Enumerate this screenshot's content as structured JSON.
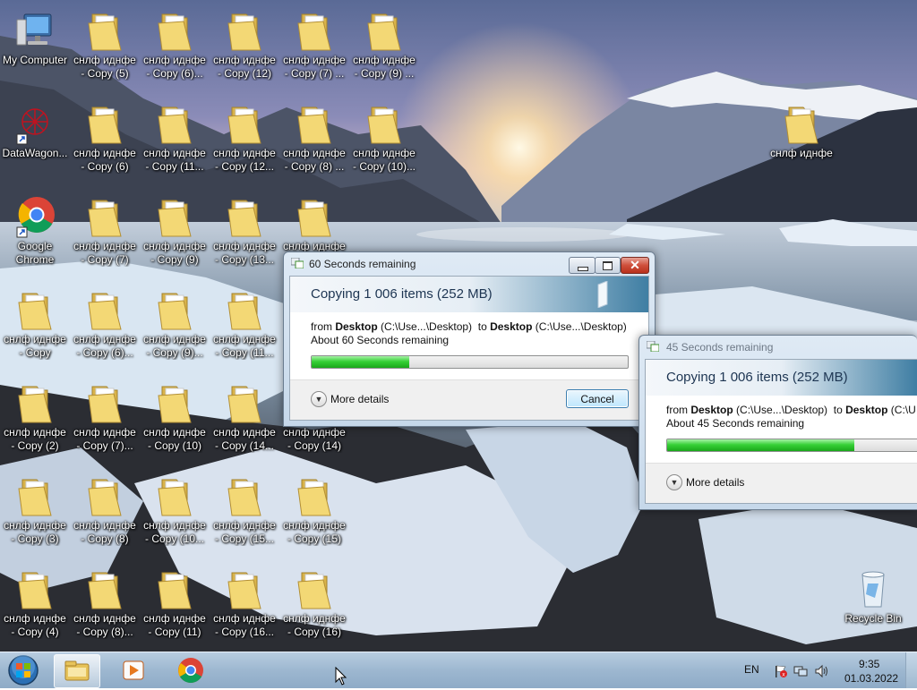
{
  "desktop": {
    "icons": [
      {
        "label": "My Computer",
        "kind": "computer"
      },
      {
        "label": "DataWagon...",
        "kind": "app"
      },
      {
        "label": "Google Chrome",
        "kind": "chrome"
      },
      {
        "label": "снлф иднфе - Copy",
        "kind": "folder"
      },
      {
        "label": "снлф иднфе - Copy (2)",
        "kind": "folder"
      },
      {
        "label": "снлф иднфе - Copy (3)",
        "kind": "folder"
      },
      {
        "label": "снлф иднфе - Copy (4)",
        "kind": "folder"
      },
      {
        "label": "снлф иднфе - Copy (5)",
        "kind": "folder"
      },
      {
        "label": "снлф иднфе - Copy (6)",
        "kind": "folder"
      },
      {
        "label": "снлф иднфе - Copy (7)",
        "kind": "folder"
      },
      {
        "label": "снлф иднфе - Copy (6)...",
        "kind": "folder"
      },
      {
        "label": "снлф иднфе - Copy (7)...",
        "kind": "folder"
      },
      {
        "label": "снлф иднфе - Copy (8)",
        "kind": "folder"
      },
      {
        "label": "снлф иднфе - Copy (8)...",
        "kind": "folder"
      },
      {
        "label": "снлф иднфе - Copy (6)...",
        "kind": "folder"
      },
      {
        "label": "снлф иднфе - Copy (11...",
        "kind": "folder"
      },
      {
        "label": "снлф иднфе - Copy (9)",
        "kind": "folder"
      },
      {
        "label": "снлф иднфе - Copy (9)...",
        "kind": "folder"
      },
      {
        "label": "снлф иднфе - Copy (10)",
        "kind": "folder"
      },
      {
        "label": "снлф иднфе - Copy (10...",
        "kind": "folder"
      },
      {
        "label": "снлф иднфе - Copy (11)",
        "kind": "folder"
      },
      {
        "label": "снлф иднфе - Copy (12)",
        "kind": "folder"
      },
      {
        "label": "снлф иднфе - Copy (12...",
        "kind": "folder"
      },
      {
        "label": "снлф иднфе - Copy (13...",
        "kind": "folder"
      },
      {
        "label": "снлф иднфе - Copy (11...",
        "kind": "folder"
      },
      {
        "label": "снлф иднфе - Copy (14...",
        "kind": "folder"
      },
      {
        "label": "снлф иднфе - Copy (15...",
        "kind": "folder"
      },
      {
        "label": "снлф иднфе - Copy (16...",
        "kind": "folder"
      },
      {
        "label": "снлф иднфе - Copy (7) ...",
        "kind": "folder"
      },
      {
        "label": "снлф иднфе - Copy (8) ...",
        "kind": "folder"
      },
      {
        "label": "снлф иднфе",
        "kind": "folder"
      },
      {
        "label": "снлф иднфе - Copy (14)",
        "kind": "folder"
      },
      {
        "label": "снлф иднфе - Copy (15)",
        "kind": "folder"
      },
      {
        "label": "снлф иднфе - Copy (16)",
        "kind": "folder"
      },
      {
        "label": "снлф иднфе - Copy (9) ...",
        "kind": "folder"
      },
      {
        "label": "снлф иднфе - Copy (10)...",
        "kind": "folder"
      },
      {
        "label": "снлф иднфе",
        "kind": "folder"
      },
      {
        "label": "Recycle Bin",
        "kind": "recycle"
      }
    ]
  },
  "dialog_main": {
    "title": "60 Seconds remaining",
    "heading": "Copying 1 006 items (252 MB)",
    "from_label": "from",
    "from_name": "Desktop",
    "from_path": "(C:\\Use...\\Desktop)",
    "to_label": "to",
    "to_name": "Desktop",
    "to_path": "(C:\\Use...\\Desktop)",
    "remaining": "About 60 Seconds remaining",
    "progress": 0.31,
    "more_details": "More details",
    "cancel": "Cancel"
  },
  "dialog_second": {
    "title": "45 Seconds remaining",
    "heading": "Copying 1 006 items (252 MB)",
    "from_label": "from",
    "from_name": "Desktop",
    "from_path": "(C:\\Use...\\Desktop)",
    "to_label": "to",
    "to_name": "Desktop",
    "to_path": "(C:\\U",
    "remaining": "About 45 Seconds remaining",
    "progress": 0.72,
    "more_details": "More details"
  },
  "taskbar": {
    "language": "EN",
    "time": "9:35",
    "date": "01.03.2022"
  },
  "colors": {
    "folder": "#f3d875",
    "progress": "#37d137",
    "taskbar": "#9db7d0"
  }
}
